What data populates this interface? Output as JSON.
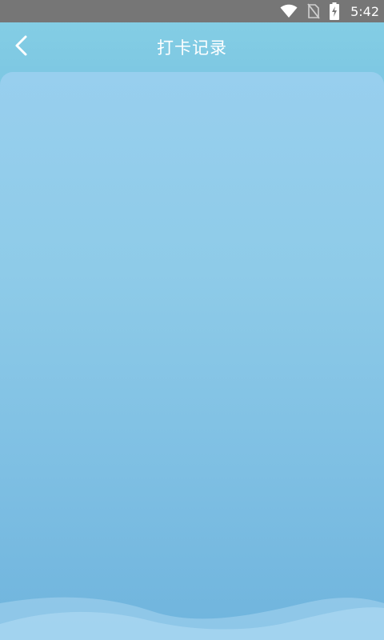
{
  "status_bar": {
    "time": "5:42",
    "icons": [
      "wifi-icon",
      "no-sim-icon",
      "battery-charging-icon"
    ]
  },
  "header": {
    "title": "打卡记录",
    "back_icon": "chevron-left-icon"
  },
  "colors": {
    "status_bar_bg": "#767676",
    "header_bg": "#80cbe3",
    "card_top": "#98cfee",
    "card_bottom": "#6fb4dd",
    "wave_light": "#a7d6f0",
    "text_white": "#ffffff"
  }
}
